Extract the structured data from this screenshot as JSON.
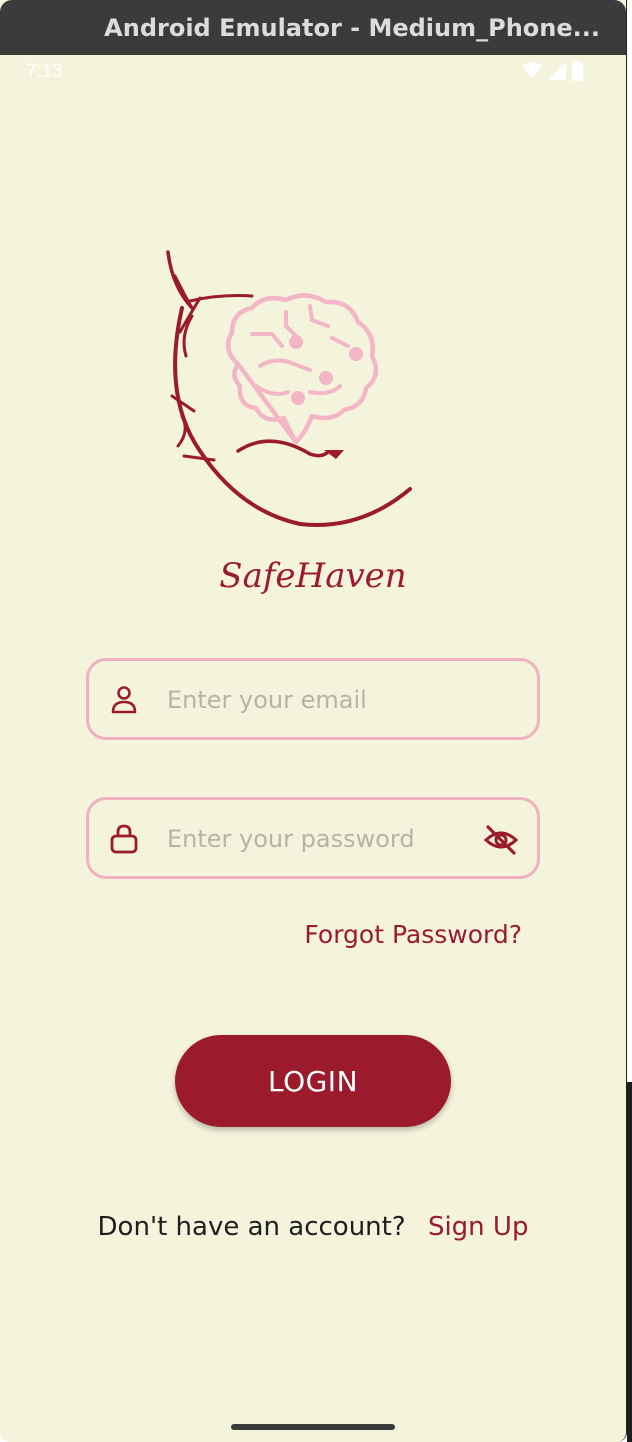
{
  "window": {
    "title": "Android Emulator - Medium_Phone..."
  },
  "status_bar": {
    "time": "7:13",
    "icons": [
      "wifi-icon",
      "signal-icon",
      "battery-icon"
    ]
  },
  "app": {
    "name": "SafeHaven"
  },
  "form": {
    "email": {
      "placeholder": "Enter your email",
      "value": "",
      "icon": "person-icon"
    },
    "password": {
      "placeholder": "Enter your password",
      "value": "",
      "icon": "lock-icon",
      "toggle_icon": "eye-off-icon"
    },
    "forgot_label": "Forgot Password?",
    "login_label": "LOGIN"
  },
  "signup": {
    "question": "Don't have an account?",
    "link_label": "Sign Up"
  },
  "colors": {
    "background": "#f4f4dc",
    "primary": "#9b1b2d",
    "field_border": "#efb1bf",
    "brain_pink": "#f2b6c6"
  }
}
